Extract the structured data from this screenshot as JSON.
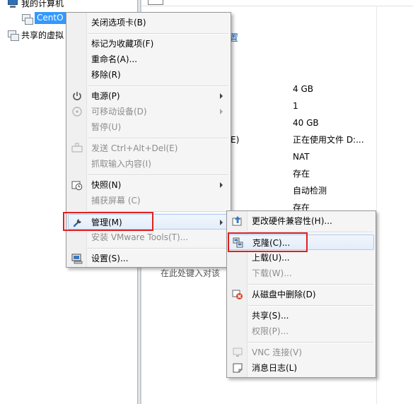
{
  "tree": {
    "my_computer": "我的计算机",
    "vm_selected": "CentO",
    "shared_vms": "共享的虚拟"
  },
  "main": {
    "settings_link": "置",
    "fragment_e": "E)",
    "hint": "在此处键入对该",
    "details": [
      "4 GB",
      "1",
      "40 GB",
      "正在使用文件 D:...",
      "NAT",
      "存在",
      "自动检测",
      "存在"
    ]
  },
  "context_menu": {
    "close_tab": "关闭选项卡(B)",
    "favorite": "标记为收藏项(F)",
    "rename": "重命名(A)...",
    "remove": "移除(R)",
    "power": "电源(P)",
    "removable": "可移动设备(D)",
    "pause": "暂停(U)",
    "send_cad": "发送 Ctrl+Alt+Del(E)",
    "grab_input": "抓取输入内容(I)",
    "snapshot": "快照(N)",
    "capture_screen": "捕获屏幕 (C)",
    "manage": "管理(M)",
    "install_tools": "安装 VMware Tools(T)...",
    "settings": "设置(S)..."
  },
  "manage_submenu": {
    "hw_compat": "更改硬件兼容性(H)...",
    "clone": "克隆(C)...",
    "upload": "上载(U)...",
    "download": "下载(W)...",
    "delete_disk": "从磁盘中删除(D)",
    "share": "共享(S)...",
    "permissions": "权限(P)...",
    "vnc": "VNC 连接(V)",
    "message_log": "消息日志(L)"
  },
  "colors": {
    "selection": "#3399ff",
    "highlight_box": "#e02020",
    "link": "#1a5fb4"
  }
}
